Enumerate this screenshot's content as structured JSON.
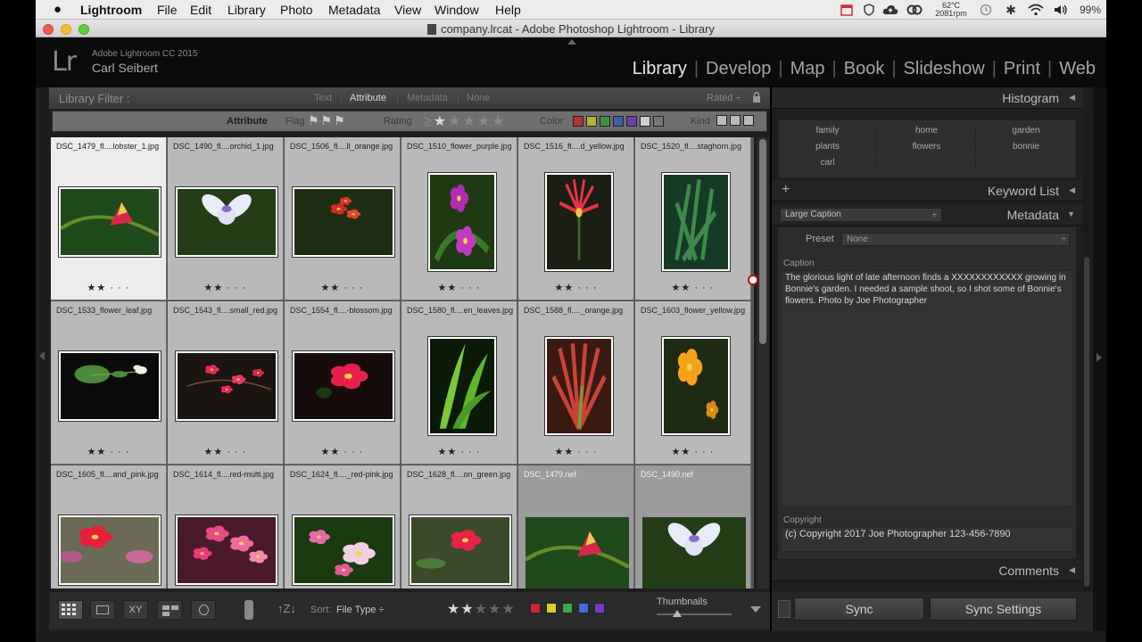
{
  "menubar": {
    "apple": "",
    "items": [
      "Lightroom",
      "File",
      "Edit",
      "Library",
      "Photo",
      "Metadata",
      "View",
      "Window",
      "Help"
    ],
    "temp": "62°C",
    "rpm": "2081rpm",
    "battery": "99%"
  },
  "window": {
    "title": "company.lrcat - Adobe Photoshop Lightroom - Library"
  },
  "identity": {
    "logo": "Lr",
    "product": "Adobe Lightroom CC 2015",
    "user": "Carl Seibert"
  },
  "modules": [
    "Library",
    "Develop",
    "Map",
    "Book",
    "Slideshow",
    "Print",
    "Web"
  ],
  "filter": {
    "label": "Library Filter :",
    "tabs": [
      "Text",
      "Attribute",
      "Metadata",
      "None"
    ],
    "rated": "Rated ÷"
  },
  "attribute": {
    "label": "Attribute",
    "flag": "Flag",
    "rating": "Rating",
    "color": "Color",
    "kind": "Kind"
  },
  "grid": [
    {
      "name": "DSC_1479_fl....lobster_1.jpg",
      "stars": "★★ · · ·",
      "tone": "sel",
      "orient": "h",
      "scene": "lobster"
    },
    {
      "name": "DSC_1490_fl....orchid_1.jpg",
      "stars": "★★ · · ·",
      "tone": "",
      "orient": "h",
      "scene": "orchid"
    },
    {
      "name": "DSC_1506_fl....ll_orange.jpg",
      "stars": "★★ · · ·",
      "tone": "",
      "orient": "h",
      "scene": "redcluster"
    },
    {
      "name": "DSC_1510_flower_purple.jpg",
      "stars": "★★ · · ·",
      "tone": "",
      "orient": "v",
      "scene": "purple"
    },
    {
      "name": "DSC_1516_fl....d_yellow.jpg",
      "stars": "★★ · · ·",
      "tone": "",
      "orient": "v",
      "scene": "spiky"
    },
    {
      "name": "DSC_1520_fl....staghorn.jpg",
      "stars": "★★ · · ·",
      "tone": "",
      "orient": "v",
      "scene": "staghorn"
    },
    {
      "name": "DSC_1533_flower_leaf.jpg",
      "stars": "★★ · · ·",
      "tone": "",
      "orient": "h",
      "scene": "leaf"
    },
    {
      "name": "DSC_1543_fl....small_red.jpg",
      "stars": "★★ · · ·",
      "tone": "",
      "orient": "h",
      "scene": "smallred"
    },
    {
      "name": "DSC_1554_fl....-blossom.jpg",
      "stars": "★★ · · ·",
      "tone": "",
      "orient": "h",
      "scene": "blossom"
    },
    {
      "name": "DSC_1580_fl....en_leaves.jpg",
      "stars": "★★ · · ·",
      "tone": "",
      "orient": "v",
      "scene": "greenleaves"
    },
    {
      "name": "DSC_1588_fl...._orange.jpg",
      "stars": "★★ · · ·",
      "tone": "",
      "orient": "v",
      "scene": "orangeleaves"
    },
    {
      "name": "DSC_1603_flower_yellow.jpg",
      "stars": "★★ · · ·",
      "tone": "",
      "orient": "v",
      "scene": "yellow"
    },
    {
      "name": "DSC_1605_fl....and_pink.jpg",
      "stars": "",
      "tone": "",
      "orient": "h",
      "scene": "redpink"
    },
    {
      "name": "DSC_1614_fl....red-multi.jpg",
      "stars": "",
      "tone": "",
      "orient": "h",
      "scene": "multi"
    },
    {
      "name": "DSC_1624_fl...._red-pink.jpg",
      "stars": "",
      "tone": "",
      "orient": "h",
      "scene": "pinkwhite"
    },
    {
      "name": "DSC_1628_fl....on_green.jpg",
      "stars": "",
      "tone": "",
      "orient": "h",
      "scene": "redgreen"
    },
    {
      "name": "DSC_1479.nef",
      "stars": "",
      "tone": "dark",
      "orient": "h",
      "scene": "lobster"
    },
    {
      "name": "DSC_1490.nef",
      "stars": "",
      "tone": "dark",
      "orient": "h",
      "scene": "orchid"
    }
  ],
  "toolbar": {
    "sort_label": "Sort:",
    "sort_value": "File Type ÷",
    "thumbnails": "Thumbnails",
    "colors": [
      "#c8283a",
      "#d8cf2a",
      "#3aa845",
      "#3a6fd8",
      "#7a3ac8"
    ]
  },
  "right": {
    "histogram": "Histogram",
    "keywords": [
      [
        "family",
        "home",
        "garden"
      ],
      [
        "plants",
        "flowers",
        "bonnie"
      ],
      [
        "carl",
        "",
        ""
      ]
    ],
    "keyword_list": "Keyword List",
    "metadata_preset_dropdown": "Large Caption",
    "metadata": "Metadata",
    "preset_label": "Preset",
    "preset_value": "None",
    "caption_label": "Caption",
    "caption_text": "The glorious light of late afternoon finds a XXXXXXXXXXXX growing in Bonnie's garden. I needed a sample shoot, so I shot some of Bonnie's flowers. Photo by Joe Photographer",
    "copyright_label": "Copyright",
    "copyright_text": "(c) Copyright 2017 Joe Photographer  123-456-7890",
    "comments": "Comments",
    "sync": "Sync",
    "sync_settings": "Sync Settings"
  }
}
